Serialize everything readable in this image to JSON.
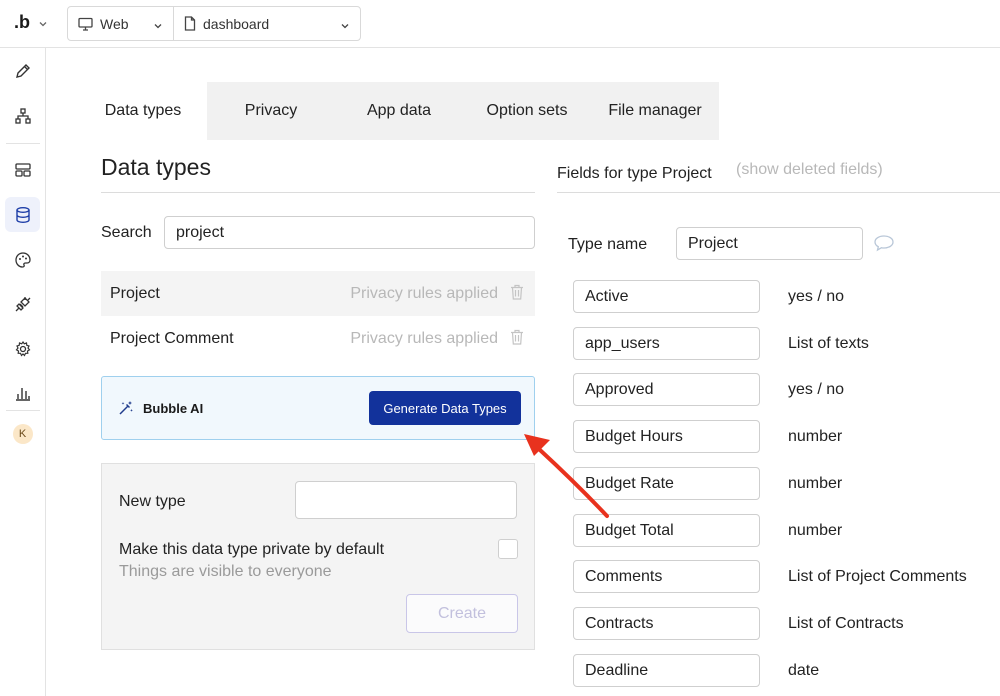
{
  "topbar": {
    "logo": ".b",
    "platform": "Web",
    "page": "dashboard"
  },
  "rail": {
    "avatar_initial": "K"
  },
  "tabs": [
    {
      "label": "Data types",
      "active": true
    },
    {
      "label": "Privacy",
      "active": false
    },
    {
      "label": "App data",
      "active": false
    },
    {
      "label": "Option sets",
      "active": false
    },
    {
      "label": "File manager",
      "active": false
    }
  ],
  "data_types_panel": {
    "title": "Data types",
    "search_label": "Search",
    "search_value": "project",
    "types": [
      {
        "name": "Project",
        "privacy": "Privacy rules applied",
        "selected": true
      },
      {
        "name": "Project Comment",
        "privacy": "Privacy rules applied",
        "selected": false
      }
    ],
    "ai": {
      "label": "Bubble AI",
      "button": "Generate Data Types"
    },
    "new_type": {
      "label": "New type",
      "value": "",
      "private_label": "Make this data type private by default",
      "private_sub": "Things are visible to everyone",
      "create_button": "Create"
    }
  },
  "fields_panel": {
    "title": "Fields for type Project",
    "deleted_link": "(show deleted fields)",
    "type_name_label": "Type name",
    "type_name_value": "Project",
    "fields": [
      {
        "name": "Active",
        "type": "yes / no"
      },
      {
        "name": "app_users",
        "type": "List of texts"
      },
      {
        "name": "Approved",
        "type": "yes / no"
      },
      {
        "name": "Budget Hours",
        "type": "number"
      },
      {
        "name": "Budget Rate",
        "type": "number"
      },
      {
        "name": "Budget Total",
        "type": "number"
      },
      {
        "name": "Comments",
        "type": "List of Project Comments"
      },
      {
        "name": "Contracts",
        "type": "List of Contracts"
      },
      {
        "name": "Deadline",
        "type": "date"
      }
    ]
  },
  "colors": {
    "accent": "#12329b",
    "annotation_arrow": "#e8321e"
  }
}
